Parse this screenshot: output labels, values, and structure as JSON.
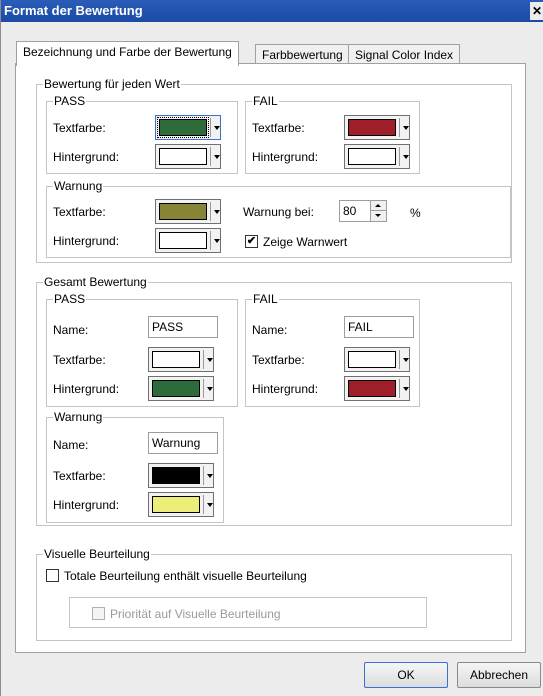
{
  "window": {
    "title": "Format der Bewertung",
    "close_glyph": "✕"
  },
  "tabs": [
    {
      "label": "Bezeichnung und Farbe der Bewertung",
      "active": true
    },
    {
      "label": "Farbbewertung",
      "active": false
    },
    {
      "label": "Signal Color Index",
      "active": false
    }
  ],
  "labels": {
    "textfarbe": "Textfarbe:",
    "hintergrund": "Hintergrund:",
    "name": "Name:"
  },
  "each_value": {
    "title": "Bewertung für jeden Wert",
    "pass": {
      "title": "PASS",
      "text_color": "#2d6b3a",
      "bg_color": "#ffffff"
    },
    "fail": {
      "title": "FAIL",
      "text_color": "#9e1f2a",
      "bg_color": "#ffffff"
    },
    "warning": {
      "title": "Warnung",
      "text_color": "#868535",
      "bg_color": "#ffffff",
      "threshold_label": "Warnung bei:",
      "threshold_value": "80",
      "threshold_unit": "%",
      "show_checkbox_label": "Zeige Warnwert",
      "show_checked": true,
      "check_glyph": "✔"
    }
  },
  "overall": {
    "title": "Gesamt Bewertung",
    "pass": {
      "title": "PASS",
      "name_value": "PASS",
      "text_color": "#ffffff",
      "bg_color": "#2d6b3a"
    },
    "fail": {
      "title": "FAIL",
      "name_value": "FAIL",
      "text_color": "#ffffff",
      "bg_color": "#9e1f2a"
    },
    "warning": {
      "title": "Warnung",
      "name_value": "Warnung",
      "text_color": "#000000",
      "bg_color": "#eded7a"
    }
  },
  "visual": {
    "title": "Visuelle Beurteilung",
    "total_checkbox_label": "Totale Beurteilung enthält visuelle Beurteilung",
    "total_checked": false,
    "priority_checkbox_label": "Priorität auf Visuelle Beurteilung",
    "priority_checked": false,
    "priority_enabled": false
  },
  "buttons": {
    "ok": "OK",
    "cancel": "Abbrechen"
  }
}
